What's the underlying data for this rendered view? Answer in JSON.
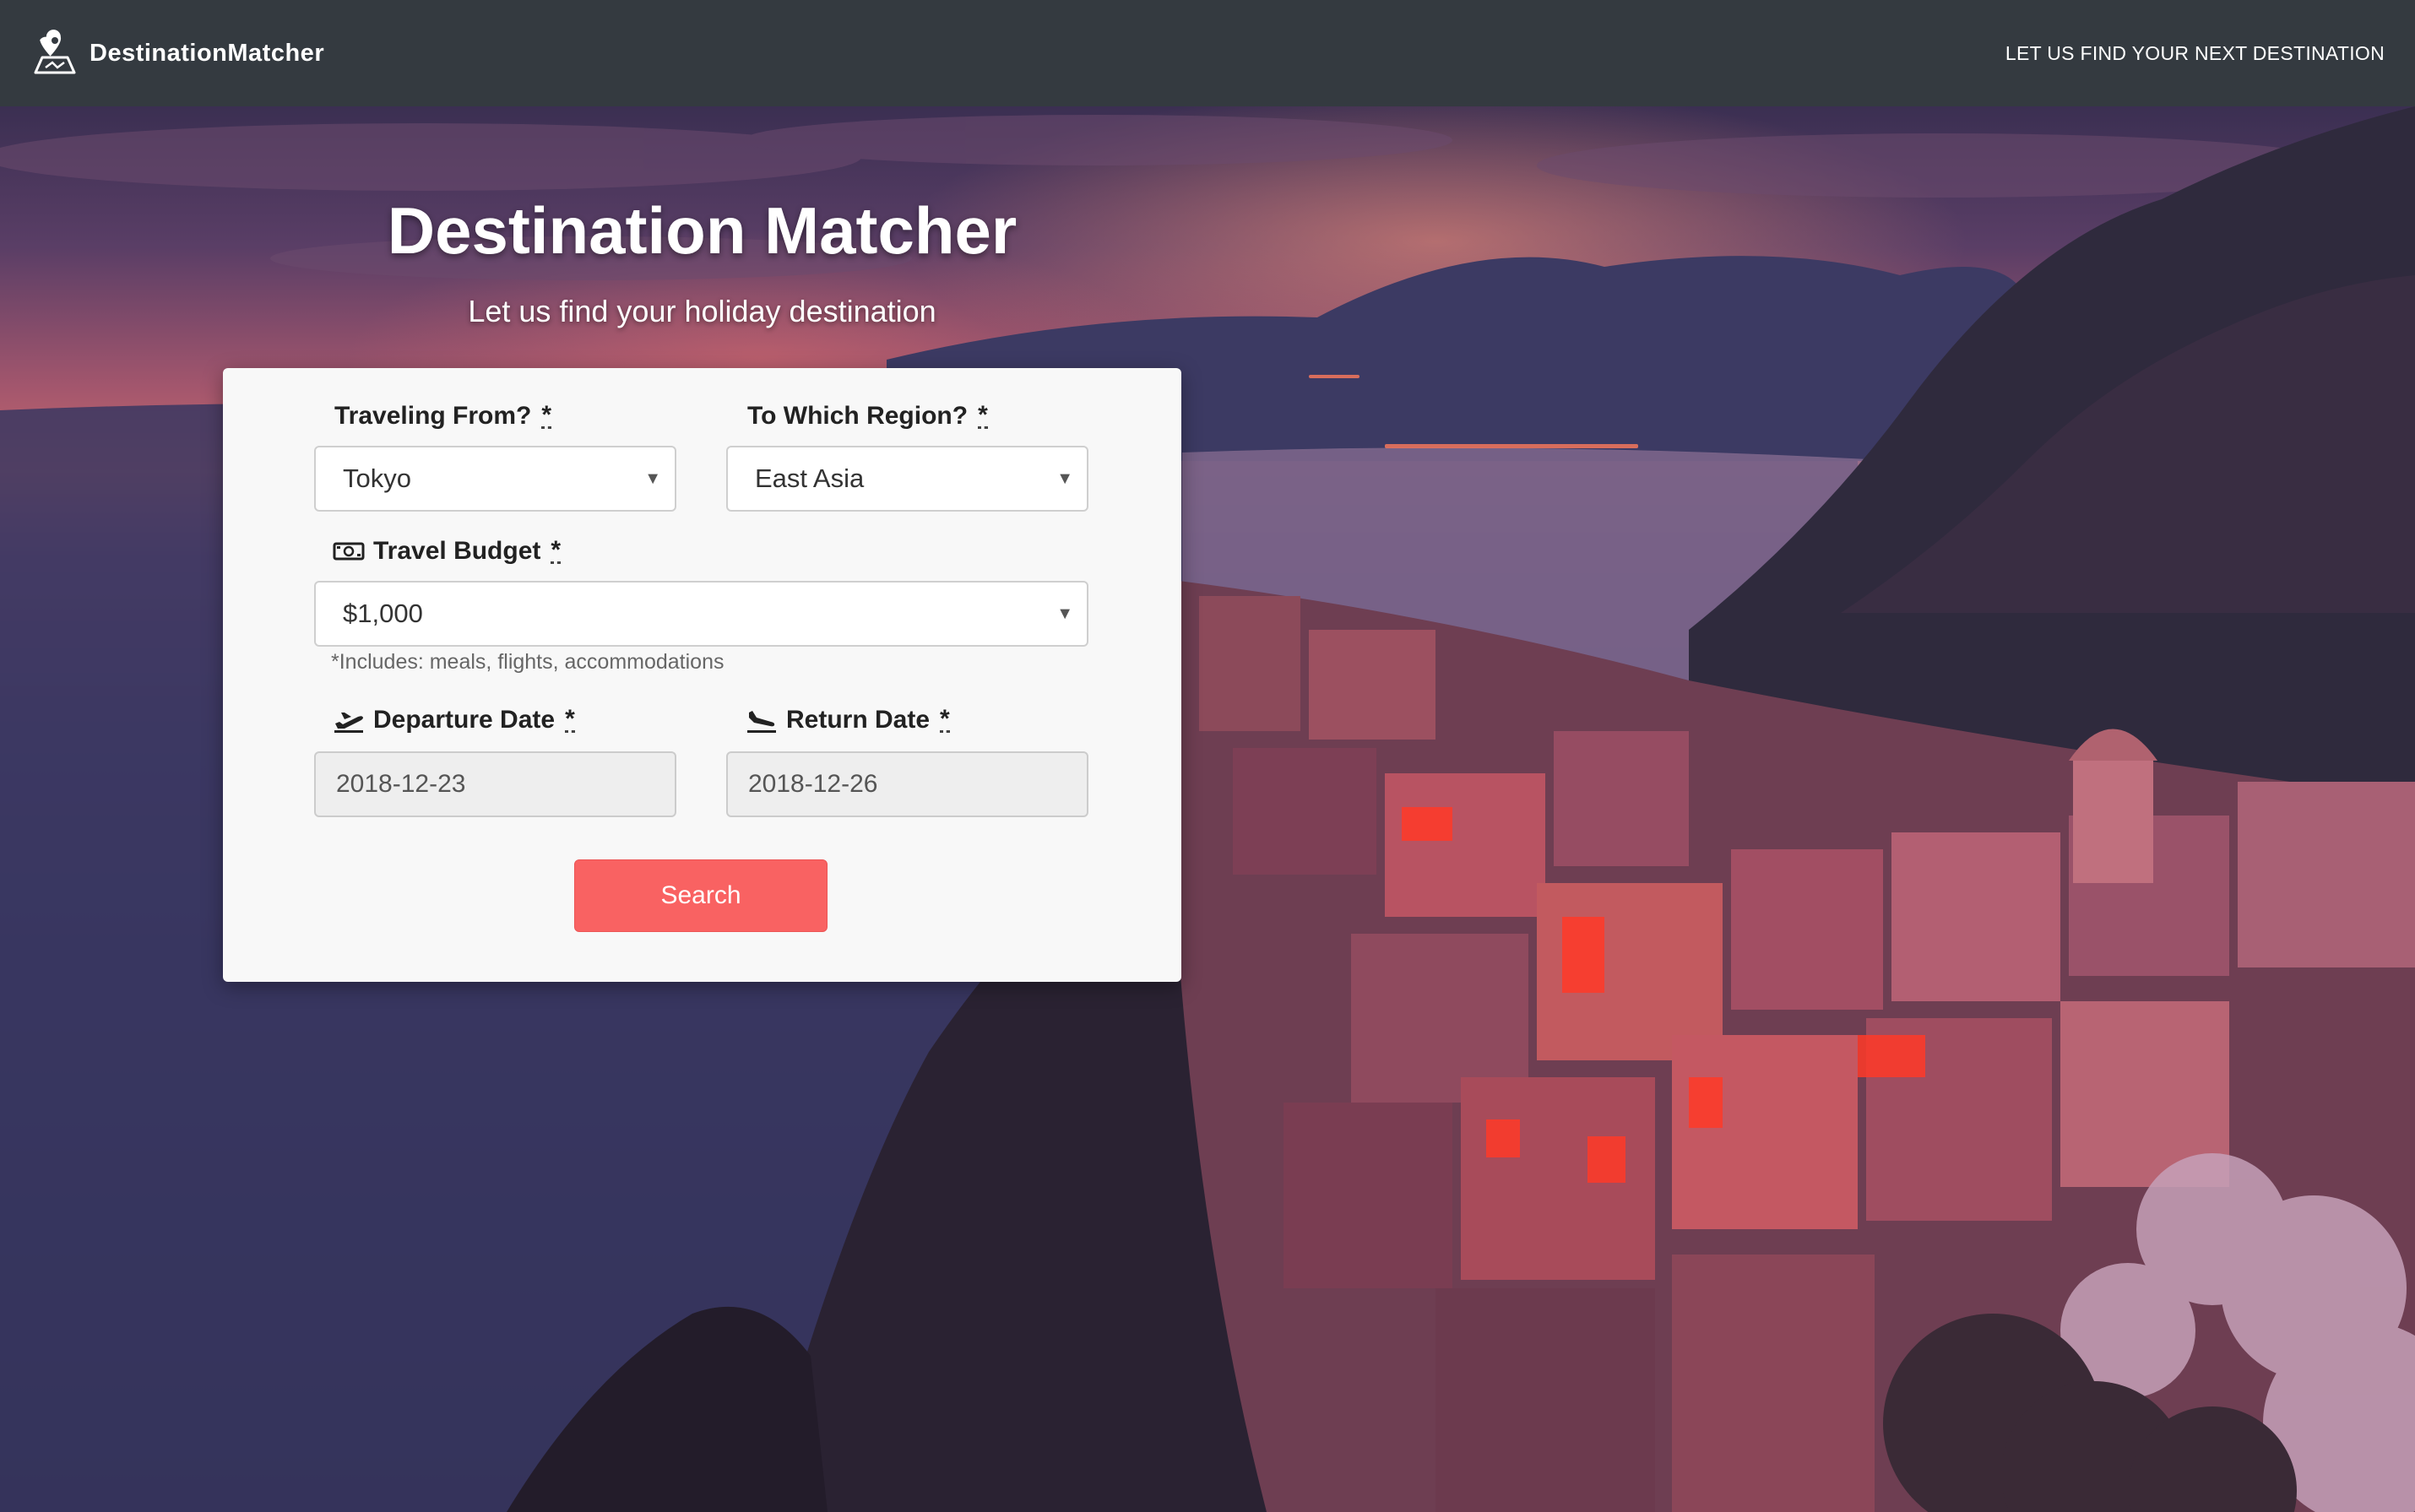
{
  "nav": {
    "brand": "DestinationMatcher",
    "link": "LET US FIND YOUR NEXT DESTINATION",
    "background_color": "#343a40",
    "logo_icon": "map-pin-icon"
  },
  "hero": {
    "title": "Destination Matcher",
    "subtitle": "Let us find your holiday destination"
  },
  "form": {
    "from": {
      "label": "Traveling From?",
      "required_mark": "*",
      "value": "Tokyo"
    },
    "region": {
      "label": "To Which Region?",
      "required_mark": "*",
      "value": "East Asia"
    },
    "budget": {
      "label": "Travel Budget",
      "required_mark": "*",
      "value": "$1,000",
      "hint": "*Includes: meals, flights, accommodations",
      "icon": "money-bill-icon"
    },
    "departure": {
      "label": "Departure Date",
      "required_mark": "*",
      "value": "2018-12-23",
      "icon": "plane-departure-icon"
    },
    "return": {
      "label": "Return Date",
      "required_mark": "*",
      "value": "2018-12-26",
      "icon": "plane-arrival-icon"
    },
    "search_label": "Search",
    "search_color": "#f96262"
  }
}
